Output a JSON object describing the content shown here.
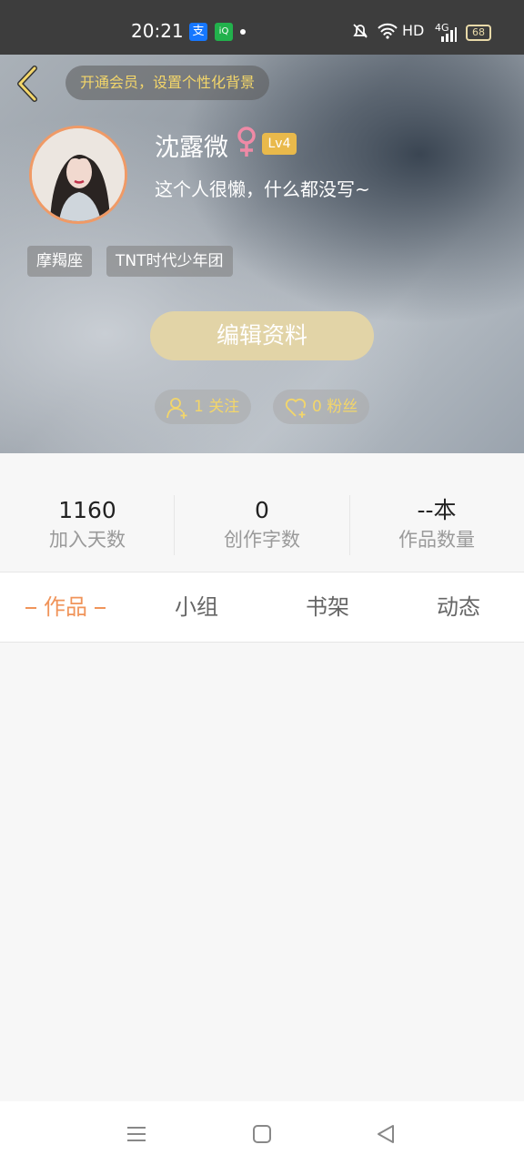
{
  "status_bar": {
    "time": "20:21",
    "apps": [
      {
        "name": "alipay-icon",
        "glyph": "支",
        "color": "#1677ff"
      },
      {
        "name": "iqiyi-icon",
        "glyph": "iQ",
        "color": "#22b14c"
      }
    ],
    "network": "HD",
    "signal": "4G",
    "battery": "68"
  },
  "header": {
    "vip_banner": "开通会员，设置个性化背景",
    "username": "沈露微",
    "level": "Lv4",
    "bio": "这个人很懒，什么都没写~",
    "tags": [
      "摩羯座",
      "TNT时代少年团"
    ],
    "edit_button": "编辑资料",
    "following": "1 关注",
    "followers": "0 粉丝"
  },
  "stats": [
    {
      "value": "1160",
      "label": "加入天数"
    },
    {
      "value": "0",
      "label": "创作字数"
    },
    {
      "value": "--本",
      "label": "作品数量"
    }
  ],
  "tabs": [
    {
      "label": "作品",
      "active": true
    },
    {
      "label": "小组",
      "active": false
    },
    {
      "label": "书架",
      "active": false
    },
    {
      "label": "动态",
      "active": false
    }
  ],
  "colors": {
    "accent": "#f0945a",
    "gold": "#f3d66a",
    "level_badge": "#e9b94b",
    "edit_button": "#e2d4a7",
    "female_symbol": "#ef8aa6"
  }
}
